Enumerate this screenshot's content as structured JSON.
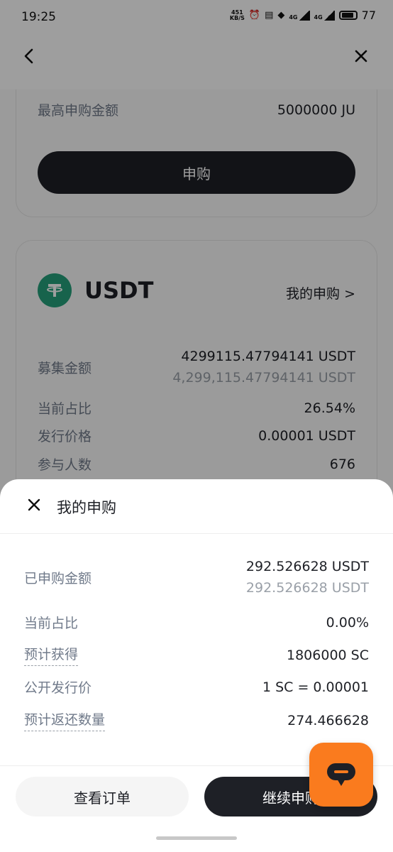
{
  "status_bar": {
    "time": "19:25",
    "net_speed": "451",
    "net_unit": "KB/S",
    "sig1": "4G",
    "sig2": "4G",
    "battery": "77"
  },
  "background": {
    "max_subscribe": {
      "label": "最高申购金额",
      "value": "5000000 JU"
    },
    "subscribe_button": "申购",
    "coin": {
      "name": "USDT",
      "my_subscription_link": "我的申购 >",
      "raise_amount": {
        "label": "募集金额",
        "value": "4299115.47794141 USDT",
        "value_formatted": "4,299,115.47794141 USDT"
      },
      "current_share": {
        "label": "当前占比",
        "value": "26.54%"
      },
      "issue_price": {
        "label": "发行价格",
        "value": "0.00001 USDT"
      },
      "participants": {
        "label": "参与人数",
        "value": "676"
      }
    }
  },
  "sheet": {
    "title": "我的申购",
    "rows": {
      "subscribed": {
        "label": "已申购金额",
        "value": "292.526628 USDT",
        "value2": "292.526628 USDT"
      },
      "share": {
        "label": "当前占比",
        "value": "0.00%"
      },
      "expected": {
        "label": "预计获得",
        "value": "1806000 SC"
      },
      "public_price": {
        "label": "公开发行价",
        "value": "1 SC = 0.00001"
      },
      "refund": {
        "label": "预计返还数量",
        "value": "274.466628"
      }
    },
    "buttons": {
      "view_orders": "查看订单",
      "continue": "继续申购"
    }
  },
  "colors": {
    "primary_dark": "#1e2026",
    "tether_green": "#26a17b",
    "chat_orange": "#fa7b1e",
    "label_gray": "#707a8a"
  }
}
